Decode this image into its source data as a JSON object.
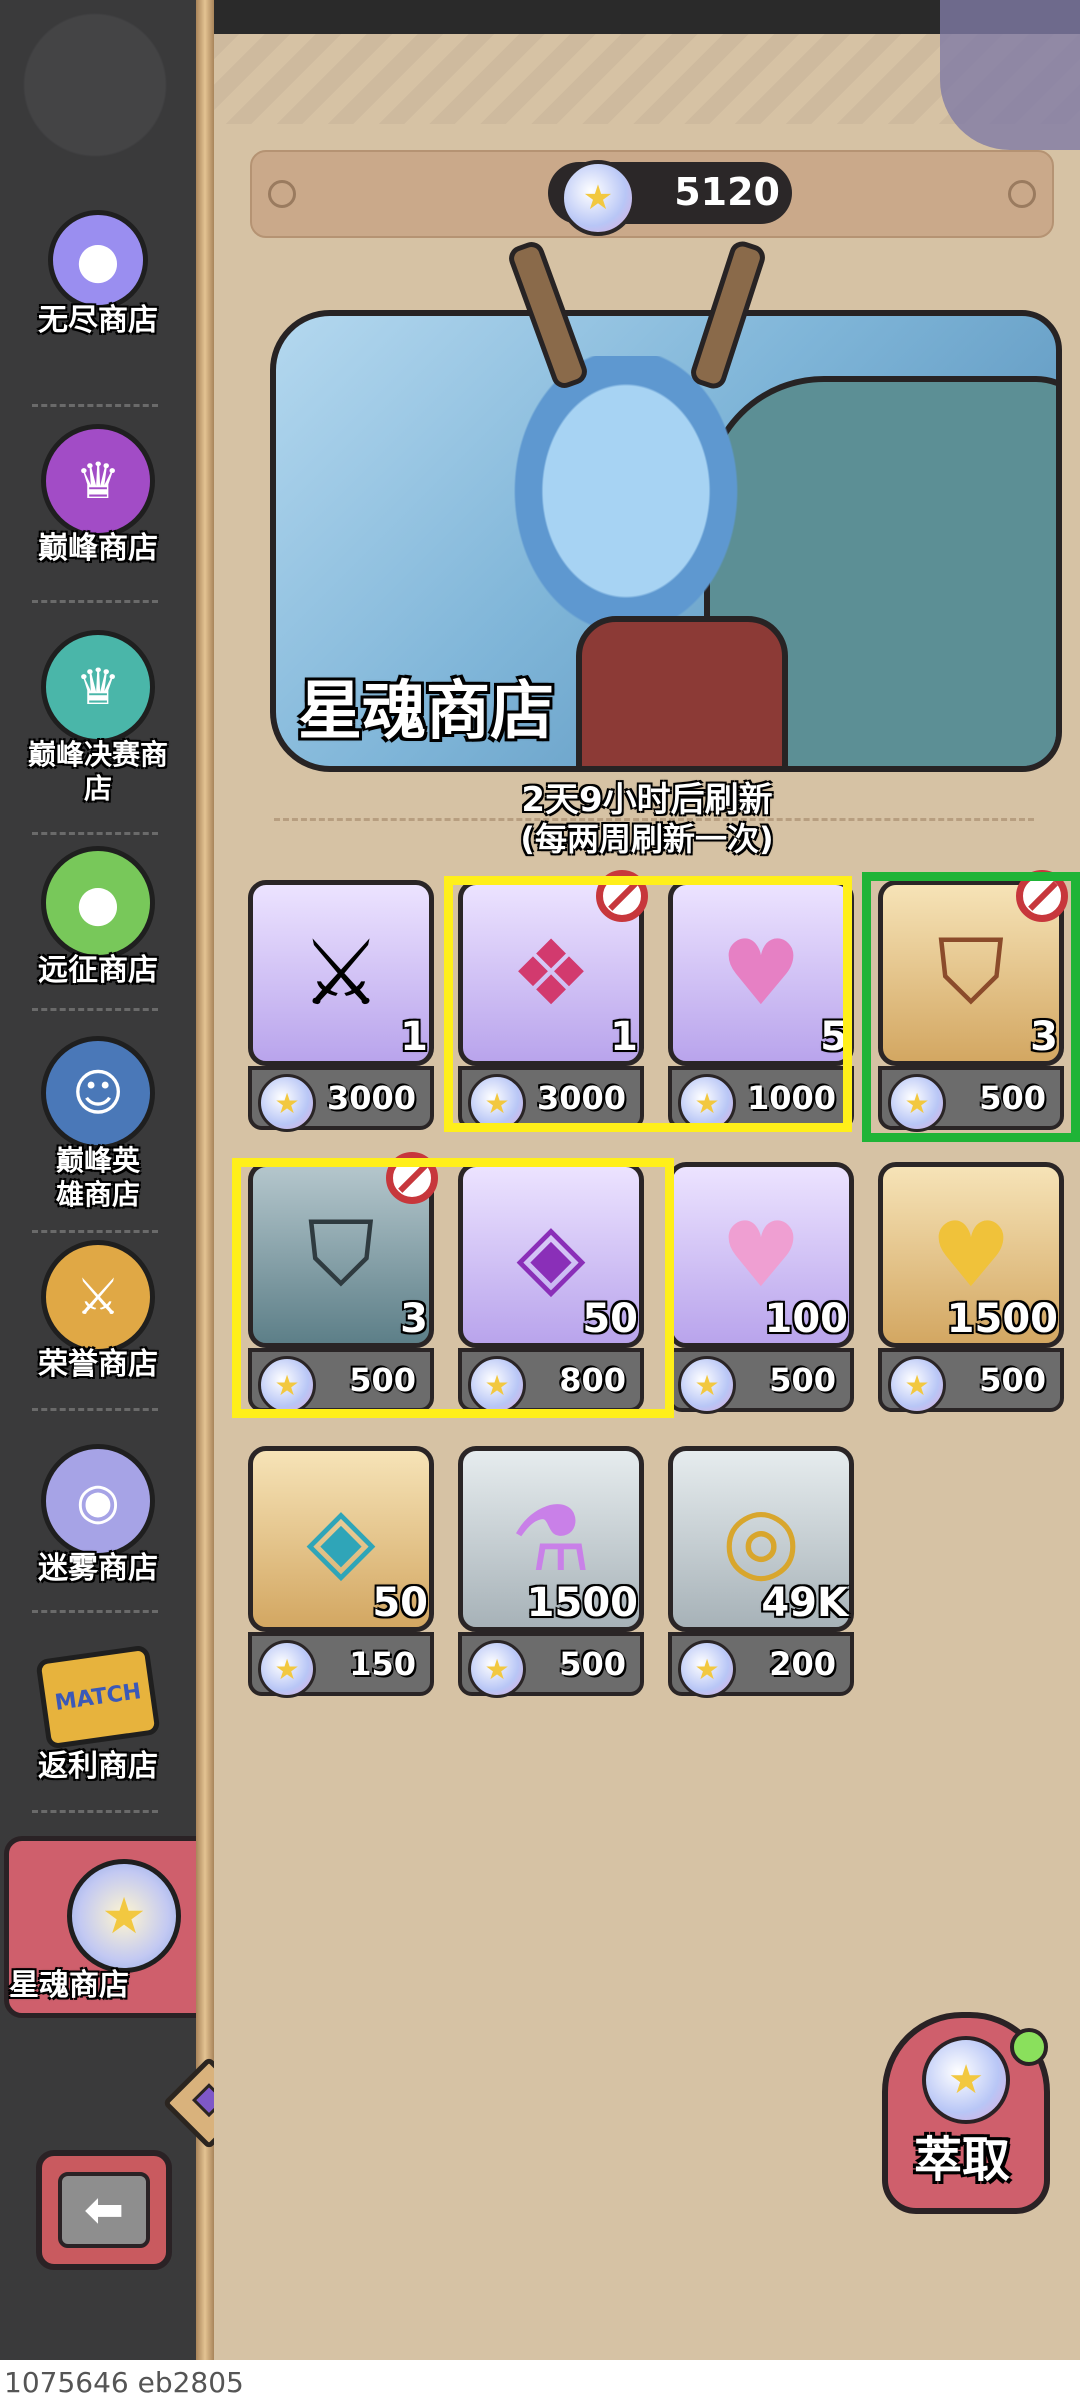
{
  "sidebar": {
    "items": [
      {
        "label": "无尽商店",
        "icon": "slime-icon",
        "glyph": "●",
        "color": "#9a8ef0"
      },
      {
        "label": "巅峰商店",
        "icon": "crown-icon",
        "glyph": "♛",
        "color": "#a24cc6"
      },
      {
        "label": "巅峰决赛商店",
        "icon": "crown-gem-icon",
        "glyph": "♛",
        "color": "#4ab6a9"
      },
      {
        "label": "远征商店",
        "icon": "green-slime-icon",
        "glyph": "●",
        "color": "#78c85a"
      },
      {
        "label": "巅峰英雄商店",
        "icon": "hero-portrait-icon",
        "glyph": "☺",
        "color": "#4a78b8"
      },
      {
        "label": "荣誉商店",
        "icon": "crossed-swords-icon",
        "glyph": "⚔",
        "color": "#e0a845"
      },
      {
        "label": "迷雾商店",
        "icon": "mist-orb-icon",
        "glyph": "◉",
        "color": "#a6a3e6"
      },
      {
        "label": "返利商店",
        "icon": "match-ticket-icon",
        "glyph": "MATCH",
        "color": "#e7b33d"
      }
    ],
    "active": {
      "label": "星魂商店",
      "icon": "star-soul-icon",
      "glyph": "★"
    }
  },
  "currency": {
    "amount": "5120",
    "icon": "star-soul-icon"
  },
  "banner": {
    "title": "星魂商店"
  },
  "refresh": {
    "line1": "2天9小时后刷新",
    "line2": "(每两周刷新一次)"
  },
  "items": [
    {
      "name": "ssr-hero-box",
      "icon": "ssr-dice-sword-icon",
      "glyph": "⚔",
      "bg": "purple",
      "qty": "1",
      "price": "3000",
      "blocked": false
    },
    {
      "name": "rune-emblem",
      "icon": "pink-rune-icon",
      "glyph": "❖",
      "bg": "purple",
      "qty": "1",
      "price": "3000",
      "blocked": true
    },
    {
      "name": "pink-shard",
      "icon": "pink-shard-icon",
      "glyph": "♥",
      "bg": "purple",
      "qty": "5",
      "price": "1000",
      "blocked": false
    },
    {
      "name": "gold-helmet-book",
      "icon": "helmet-book-icon",
      "glyph": "⛉",
      "bg": "gold",
      "qty": "3",
      "price": "500",
      "blocked": true
    },
    {
      "name": "teal-helmet-book",
      "icon": "helmet-book-icon",
      "glyph": "⛉",
      "bg": "purple",
      "qty": "3",
      "price": "500",
      "blocked": true
    },
    {
      "name": "purple-orb",
      "icon": "purple-orb-icon",
      "glyph": "◈",
      "bg": "purple",
      "qty": "50",
      "price": "800",
      "blocked": false
    },
    {
      "name": "crystal-heart",
      "icon": "crystal-heart-icon",
      "glyph": "♥",
      "bg": "purple",
      "qty": "100",
      "price": "500",
      "blocked": false
    },
    {
      "name": "gold-heart",
      "icon": "gold-heart-icon",
      "glyph": "♥",
      "bg": "gold",
      "qty": "1500",
      "price": "500",
      "blocked": false
    },
    {
      "name": "teal-orb",
      "icon": "teal-orb-icon",
      "glyph": "◈",
      "bg": "gold",
      "qty": "50",
      "price": "150",
      "blocked": false
    },
    {
      "name": "potion",
      "icon": "potion-bottle-icon",
      "glyph": "⚗",
      "bg": "gray",
      "qty": "1500",
      "price": "500",
      "blocked": false
    },
    {
      "name": "gold-coin",
      "icon": "gold-coin-icon",
      "glyph": "◎",
      "bg": "gray",
      "qty": "49K",
      "price": "200",
      "blocked": false
    }
  ],
  "extract_button": {
    "label": "萃取",
    "icon": "star-soul-icon"
  },
  "back_button": {
    "icon": "back-arrow-icon",
    "glyph": "⬅"
  },
  "build_id": "1075646 eb2805",
  "colors": {
    "highlight_yellow": "#ffef1a",
    "highlight_green": "#1fb437",
    "accent_red": "#cf5f6c"
  }
}
